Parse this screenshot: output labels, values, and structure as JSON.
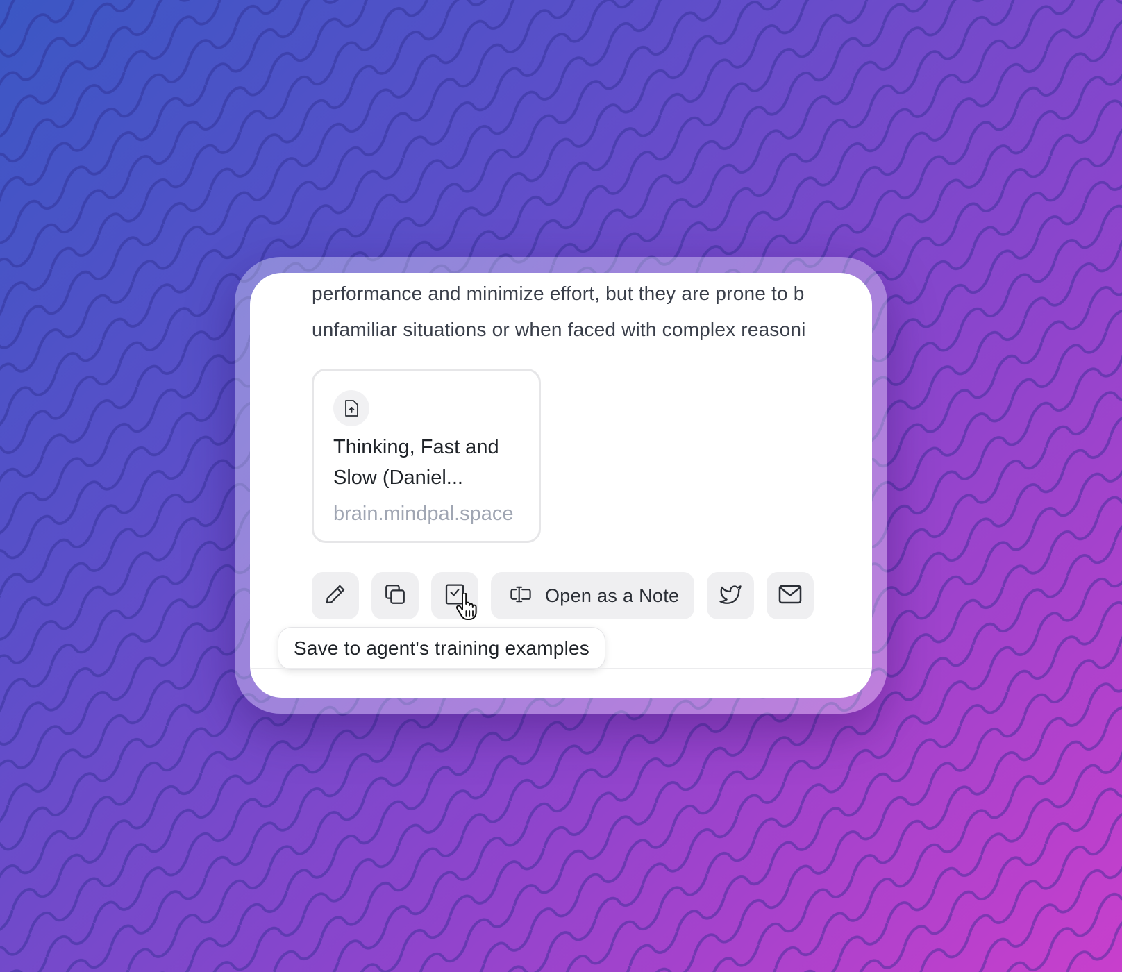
{
  "message": {
    "lines": [
      "performance and minimize effort, but they are prone to b",
      "unfamiliar situations or when faced with complex reasoni"
    ]
  },
  "source_card": {
    "icon": "file-upload-icon",
    "title": "Thinking, Fast and Slow (Daniel...",
    "domain": "brain.mindpal.space"
  },
  "actions": {
    "edit_icon": "pencil-icon",
    "copy_icon": "copy-icon",
    "save_icon": "checklist-icon",
    "open_note_label": "Open as a Note",
    "twitter_icon": "twitter-icon",
    "mail_icon": "mail-icon"
  },
  "tooltip": {
    "text": "Save to agent's training examples"
  },
  "colors": {
    "background_start": "#3b57c4",
    "background_end": "#c83fcc",
    "button_bg": "#efeff1",
    "domain_text": "#a0a6b3"
  }
}
